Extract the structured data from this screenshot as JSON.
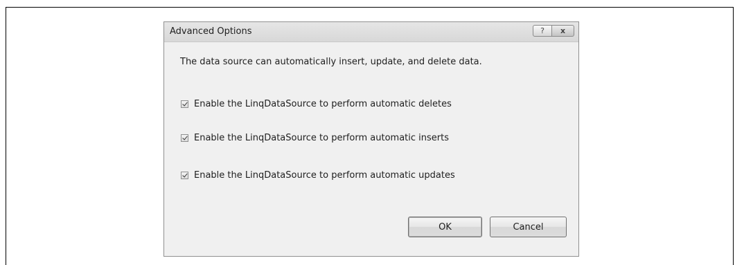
{
  "dialog": {
    "title": "Advanced Options",
    "help_button": "?",
    "close_button": "x",
    "description": "The data source can automatically insert, update, and delete data.",
    "options": [
      {
        "label": "Enable the LinqDataSource to perform automatic deletes",
        "checked": true
      },
      {
        "label": "Enable the LinqDataSource to perform automatic inserts",
        "checked": true
      },
      {
        "label": "Enable the LinqDataSource to perform automatic updates",
        "checked": true
      }
    ],
    "ok_label": "OK",
    "cancel_label": "Cancel"
  }
}
